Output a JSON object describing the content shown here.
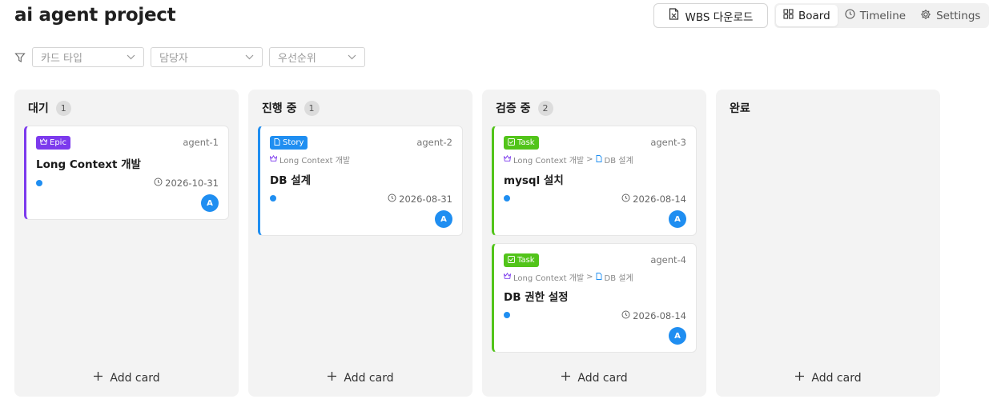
{
  "project": {
    "title": "ai agent project"
  },
  "header": {
    "wbs_label": "WBS 다운로드",
    "views": [
      {
        "label": "Board",
        "icon": "grid-icon",
        "active": true
      },
      {
        "label": "Timeline",
        "icon": "clock-icon",
        "active": false
      },
      {
        "label": "Settings",
        "icon": "gear-icon",
        "active": false
      }
    ]
  },
  "filters": [
    {
      "placeholder": "카드 타입"
    },
    {
      "placeholder": "담당자"
    },
    {
      "placeholder": "우선순위"
    }
  ],
  "colors": {
    "epic": "#7c3aed",
    "story": "#1f8ef1",
    "task": "#52c41a",
    "accent": "#1f8ef1"
  },
  "columns": [
    {
      "title": "대기",
      "count": "1",
      "add_label": "Add card",
      "cards": [
        {
          "type": "Epic",
          "id": "agent-1",
          "crumb": null,
          "title": "Long Context 개발",
          "due": "2026-10-31",
          "avatar": "A"
        }
      ]
    },
    {
      "title": "진행 중",
      "count": "1",
      "add_label": "Add card",
      "cards": [
        {
          "type": "Story",
          "id": "agent-2",
          "crumb": {
            "epic": "Long Context 개발",
            "story": null
          },
          "title": "DB 설계",
          "due": "2026-08-31",
          "avatar": "A"
        }
      ]
    },
    {
      "title": "검증 중",
      "count": "2",
      "add_label": "Add card",
      "cards": [
        {
          "type": "Task",
          "id": "agent-3",
          "crumb": {
            "epic": "Long Context 개발",
            "separator": ">",
            "story": "DB 설계"
          },
          "title": "mysql 설치",
          "due": "2026-08-14",
          "avatar": "A"
        },
        {
          "type": "Task",
          "id": "agent-4",
          "crumb": {
            "epic": "Long Context 개발",
            "separator": ">",
            "story": "DB 설계"
          },
          "title": "DB 권한 설정",
          "due": "2026-08-14",
          "avatar": "A"
        }
      ]
    },
    {
      "title": "완료",
      "count": null,
      "add_label": "Add card",
      "cards": []
    }
  ]
}
